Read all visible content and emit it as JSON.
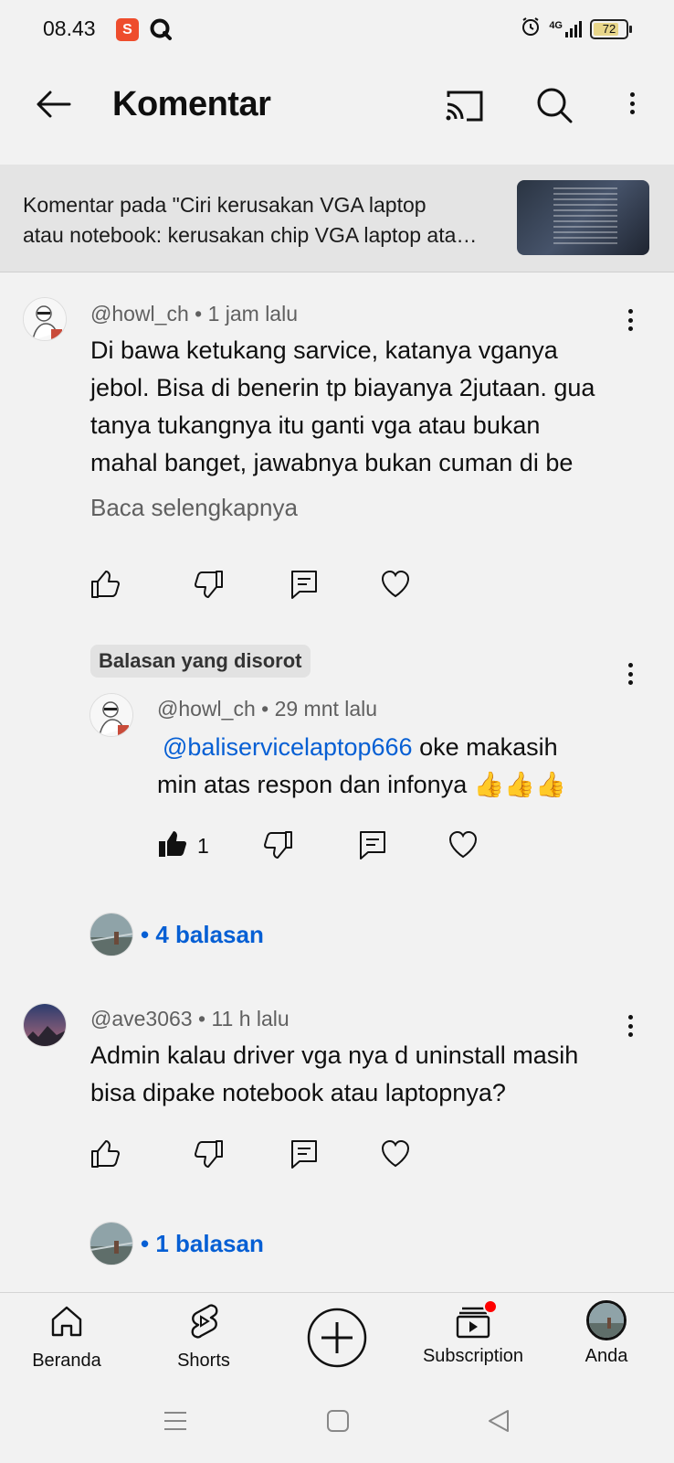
{
  "status_bar": {
    "time": "08.43",
    "shopee_label": "S",
    "network": "4G",
    "battery": "72"
  },
  "header": {
    "title": "Komentar",
    "back_icon": "arrow-left-icon",
    "cast_icon": "cast-icon",
    "search_icon": "search-icon",
    "more_icon": "more-vertical-icon"
  },
  "video_banner": {
    "line1": "Komentar pada \"Ciri kerusakan VGA laptop",
    "line2": "atau notebook: kerusakan chip VGA laptop ata…"
  },
  "comments": [
    {
      "author": "@howl_ch",
      "time": "• 1 jam lalu",
      "lines": [
        "Di bawa ketukang sarvice, katanya vganya",
        "jebol. Bisa di benerin tp biayanya 2jutaan. gua",
        "tanya tukangnya itu ganti vga atau bukan",
        "mahal banget, jawabnya bukan cuman di be"
      ],
      "read_more": "Baca selengkapnya",
      "highlight_chip": "Balasan yang disorot",
      "highlighted_reply": {
        "author": "@howl_ch",
        "time": "• 29 mnt lalu",
        "mention": "@baliservicelaptop666",
        "line1_rest": " oke makasih",
        "line2": "min atas respon dan infonya 👍👍👍",
        "like_count": "1"
      },
      "replies_label": "• 4 balasan"
    },
    {
      "author": "@ave3063",
      "time": "• 11 h lalu",
      "lines": [
        "Admin kalau driver vga nya d uninstall masih",
        "bisa dipake notebook atau laptopnya?"
      ],
      "replies_label": "• 1 balasan"
    }
  ],
  "bottom_nav": {
    "items": [
      {
        "label": "Beranda",
        "icon": "home-icon"
      },
      {
        "label": "Shorts",
        "icon": "shorts-icon"
      },
      {
        "label": "",
        "icon": "create-plus-icon"
      },
      {
        "label": "Subscription",
        "icon": "subscriptions-icon"
      },
      {
        "label": "Anda",
        "icon": "profile-avatar"
      }
    ]
  },
  "colors": {
    "background": "#f2f2f2",
    "link": "#065fd4",
    "notification_dot": "#ff0000"
  }
}
